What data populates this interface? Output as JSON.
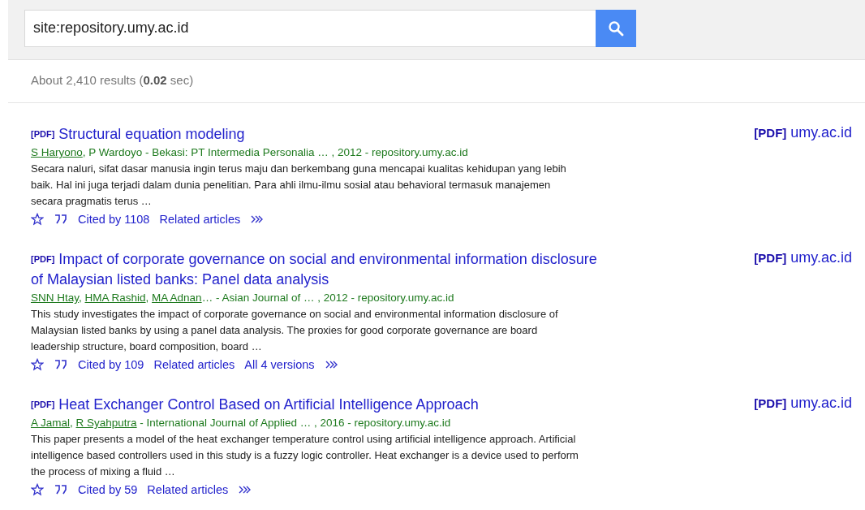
{
  "search": {
    "value": "site:repository.umy.ac.id"
  },
  "stats": {
    "prefix": "About 2,410 results (",
    "time": "0.02",
    "suffix": " sec)"
  },
  "results": [
    {
      "tag": "[PDF]",
      "title": "Structural equation modeling",
      "byline": [
        {
          "text": "S Haryono",
          "linked": true
        },
        {
          "text": ", P Wardoyo - Bekasi: PT Intermedia Personalia … , 2012 - repository.umy.ac.id",
          "linked": false
        }
      ],
      "snippet": "Secara naluri, sifat dasar manusia ingin terus maju dan berkembang guna mencapai kualitas kehidupan yang lebih baik. Hal ini juga terjadi dalam dunia penelitian. Para ahli ilmu-ilmu sosial atau behavioral termasuk manajemen secara pragmatis terus …",
      "links": [
        "Cited by 1108",
        "Related articles"
      ],
      "side": {
        "tag": "[PDF]",
        "domain": "umy.ac.id"
      }
    },
    {
      "tag": "[PDF]",
      "title": "Impact of corporate governance on social and environmental information disclosure of Malaysian listed banks: Panel data analysis",
      "byline": [
        {
          "text": "SNN Htay",
          "linked": true
        },
        {
          "text": ", ",
          "linked": false
        },
        {
          "text": "HMA Rashid",
          "linked": true
        },
        {
          "text": ", ",
          "linked": false
        },
        {
          "text": "MA Adnan",
          "linked": true
        },
        {
          "text": "… - Asian Journal of … , 2012 - repository.umy.ac.id",
          "linked": false
        }
      ],
      "snippet": "This study investigates the impact of corporate governance on social and environmental information disclosure of Malaysian listed banks by using a panel data analysis. The proxies for good corporate governance are board leadership structure, board composition, board …",
      "links": [
        "Cited by 109",
        "Related articles",
        "All 4 versions"
      ],
      "side": {
        "tag": "[PDF]",
        "domain": "umy.ac.id"
      }
    },
    {
      "tag": "[PDF]",
      "title": "Heat Exchanger Control Based on Artificial Intelligence Approach",
      "byline": [
        {
          "text": "A Jamal",
          "linked": true
        },
        {
          "text": ", ",
          "linked": false
        },
        {
          "text": "R Syahputra",
          "linked": true
        },
        {
          "text": " - International Journal of Applied … , 2016 - repository.umy.ac.id",
          "linked": false
        }
      ],
      "snippet": "This paper presents a model of the heat exchanger temperature control using artificial intelligence approach. Artificial intelligence based controllers used in this study is a fuzzy logic controller. Heat exchanger is a device used to perform the process of mixing a fluid …",
      "links": [
        "Cited by 59",
        "Related articles"
      ],
      "side": {
        "tag": "[PDF]",
        "domain": "umy.ac.id"
      }
    }
  ]
}
